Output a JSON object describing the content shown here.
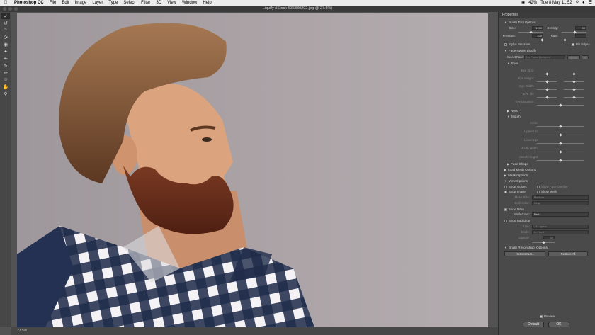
{
  "menubar": {
    "app_name": "Photoshop CC",
    "items": [
      "File",
      "Edit",
      "Image",
      "Layer",
      "Type",
      "Select",
      "Filter",
      "3D",
      "View",
      "Window",
      "Help"
    ],
    "battery": "42%",
    "datetime": "Tue 8 May  11:52"
  },
  "window": {
    "title": "Liquify (iStock-636830292.jpg @ 27.5%)"
  },
  "status": {
    "zoom": "27.5%"
  },
  "panel": {
    "title": "Properties",
    "brush_tool_options": {
      "header": "Brush Tool Options",
      "size_label": "Size:",
      "size_value": "1150",
      "density_label": "Density:",
      "density_value": "50",
      "pressure_label": "Pressure:",
      "pressure_value": "100",
      "rate_label": "Rate:",
      "rate_value": "",
      "stylus_pressure": "Stylus Pressure",
      "pin_edges": "Pin Edges"
    },
    "face_aware": {
      "header": "Face-Aware Liquify",
      "select_face_label": "Select Face:",
      "select_face_value": "No Faces Detected",
      "reset_label": "Reset",
      "all_label": "All",
      "eyes_header": "Eyes",
      "eye_rows": [
        "Eye Size:",
        "Eye Height:",
        "Eye Width:",
        "Eye Tilt:",
        "Eye Distance:"
      ],
      "nose_header": "Nose",
      "mouth_header": "Mouth",
      "mouth_rows": [
        "Smile:",
        "Upper Lip:",
        "Lower Lip:",
        "Mouth Width:",
        "Mouth Height:"
      ],
      "face_shape_header": "Face Shape"
    },
    "load_mesh_options": "Load Mesh Options",
    "mask_options": "Mask Options",
    "view_options": {
      "header": "View Options",
      "show_guides": "Show Guides",
      "show_face_overlay": "Show Face Overlay",
      "show_image": "Show Image",
      "show_mesh": "Show Mesh",
      "mesh_size_label": "Mesh Size:",
      "mesh_size_value": "Medium",
      "mesh_color_label": "Mesh Color:",
      "mesh_color_value": "Gray",
      "show_mask": "Show Mask",
      "mask_color_label": "Mask Color:",
      "mask_color_value": "Red",
      "show_backdrop": "Show Backdrop",
      "use_label": "Use:",
      "use_value": "All Layers",
      "mode_label": "Mode:",
      "mode_value": "In Front",
      "opacity_label": "Opacity:",
      "opacity_value": "50"
    },
    "brush_reconstruct": {
      "header": "Brush Reconstruct Options",
      "reconstruct_label": "Reconstruct...",
      "restore_all_label": "Restore All"
    },
    "preview_label": "Preview",
    "default_label": "Default",
    "ok_label": "OK"
  },
  "colors": {
    "background_left": "#a39ba0",
    "background_right": "#b0a8ab",
    "shirt_navy": "#1f2c4a",
    "beard": "#6b2e1c",
    "hair": "#7a4a2c",
    "skin": "#d9a07a"
  }
}
